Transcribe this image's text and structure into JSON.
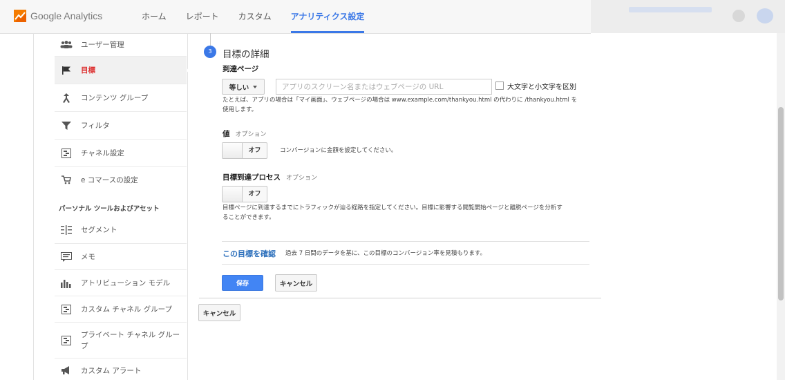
{
  "header": {
    "logo_text": "Google Analytics",
    "nav": [
      {
        "label": "ホーム",
        "active": false
      },
      {
        "label": "レポート",
        "active": false
      },
      {
        "label": "カスタム",
        "active": false
      },
      {
        "label": "アナリティクス設定",
        "active": true
      }
    ]
  },
  "sidebar": {
    "items": [
      {
        "label": "ユーザー管理",
        "icon": "users-icon",
        "active": false
      },
      {
        "label": "目標",
        "icon": "flag-icon",
        "active": true
      },
      {
        "label": "コンテンツ グループ",
        "icon": "content-group-icon",
        "active": false
      },
      {
        "label": "フィルタ",
        "icon": "filter-icon",
        "active": false
      },
      {
        "label": "チャネル設定",
        "icon": "channel-icon",
        "active": false
      },
      {
        "label": "e コマースの設定",
        "icon": "cart-icon",
        "active": false
      }
    ],
    "section_title": "パーソナル ツールおよびアセット",
    "personal_items": [
      {
        "label": "セグメント",
        "icon": "segment-icon"
      },
      {
        "label": "メモ",
        "icon": "memo-icon"
      },
      {
        "label": "アトリビューション モデル",
        "icon": "bar-chart-icon"
      },
      {
        "label": "カスタム チャネル グループ",
        "icon": "channel-icon"
      },
      {
        "label": "プライベート チャネル グループ",
        "icon": "channel-icon"
      },
      {
        "label": "カスタム アラート",
        "icon": "megaphone-icon"
      }
    ]
  },
  "goal_details": {
    "step_number": "3",
    "title": "目標の詳細",
    "destination": {
      "label": "到達ページ",
      "match_type": "等しい",
      "url_value": "",
      "url_placeholder": "アプリのスクリーン名またはウェブページの URL",
      "case_sensitive_label": "大文字と小文字を区別",
      "case_sensitive_checked": false,
      "help_line1": "たとえば、アプリの場合は「マイ画面」、ウェブページの場合は www.example.com/thankyou.html の代わりに /thankyou.html を",
      "help_line2": "使用します。"
    },
    "value": {
      "label": "値",
      "optional": "オプション",
      "toggle": "オフ",
      "help": "コンバージョンに金額を設定してください。"
    },
    "funnel": {
      "label": "目標到達プロセス",
      "optional": "オプション",
      "toggle": "オフ",
      "help_line1": "目標ページに到達するまでにトラフィックが辿る経路を指定してください。目標に影響する閲覧開始ページと離脱ページを分析す",
      "help_line2": "ることができます。"
    },
    "verify": {
      "link": "この目標を確認",
      "text": "過去 7 日間のデータを基に、この目標のコンバージョン率を見積もります。"
    },
    "save_label": "保存",
    "cancel_label": "キャンセル"
  },
  "outer_cancel_label": "キャンセル",
  "colors": {
    "accent": "#3b78e7",
    "active_nav": "#3b78e7",
    "active_side": "#dd3333",
    "save_button": "#4285f4",
    "link": "#2a6ebb"
  }
}
